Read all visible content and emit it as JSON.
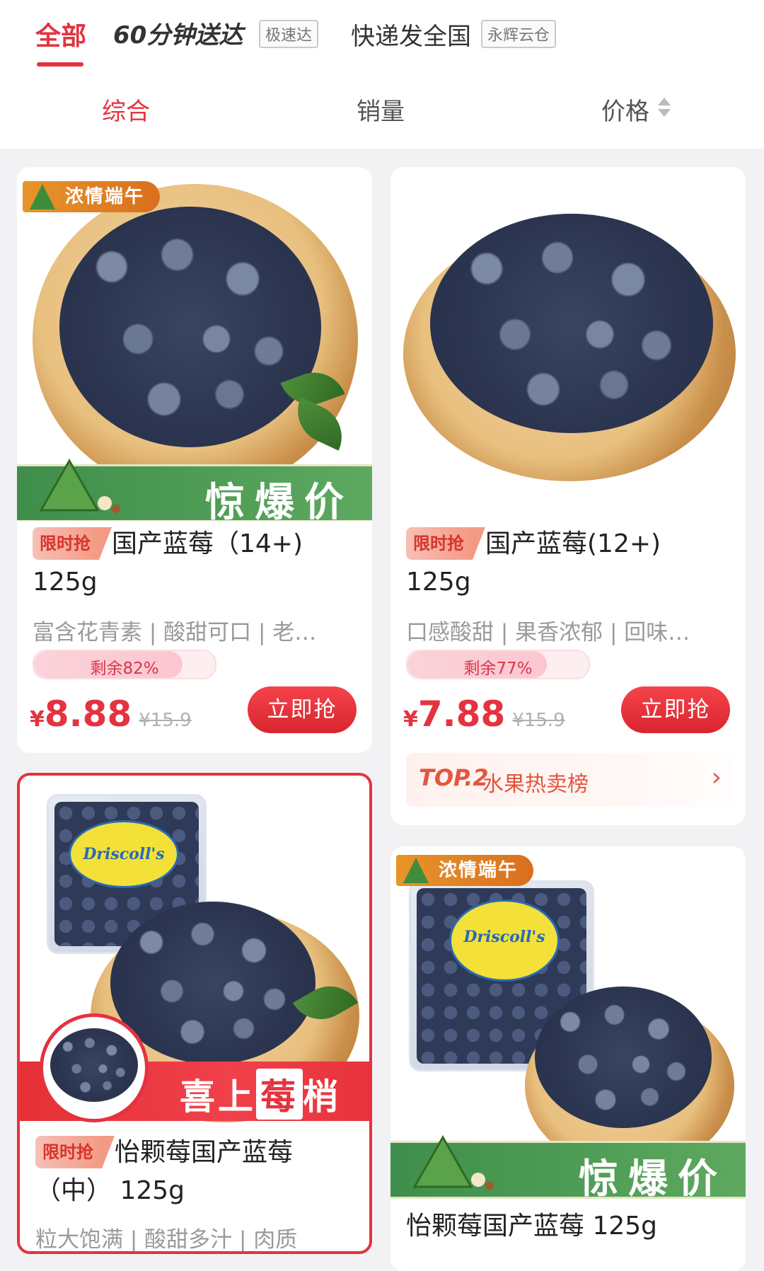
{
  "tabs": {
    "all": "全部",
    "sixty_min": "60分钟送达",
    "sixty_min_tag": "极速达",
    "express": "快递发全国",
    "express_tag": "永辉云仓"
  },
  "sort": {
    "comprehensive": "综合",
    "sales": "销量",
    "price": "价格"
  },
  "products": [
    {
      "ribbon": "浓情端午",
      "banner": "惊爆价",
      "tag": "限时抢",
      "title_line1": "国产蓝莓（14+)",
      "title_line2": "125g",
      "subtitle": "富含花青素 | 酸甜可口 | 老…",
      "remaining": "剩余82%",
      "remaining_fraction": 0.82,
      "currency": "¥",
      "price": "8.88",
      "orig_price": "¥15.9",
      "buy": "立即抢"
    },
    {
      "tag": "限时抢",
      "title_line1": "国产蓝莓(12+)",
      "title_line2": "125g",
      "subtitle": "口感酸甜 | 果香浓郁 | 回味…",
      "remaining": "剩余77%",
      "remaining_fraction": 0.77,
      "currency": "¥",
      "price": "7.88",
      "orig_price": "¥15.9",
      "buy": "立即抢",
      "rank_top": "TOP.2",
      "rank_name": "水果热卖榜",
      "rank_chevron": "›"
    },
    {
      "brand": "Driscoll's",
      "banner_pre": "喜上",
      "banner_hl": "莓",
      "banner_post": "梢",
      "tag": "限时抢",
      "title_line1": "怡颗莓国产蓝莓",
      "title_line2": "（中） 125g",
      "subtitle": "粒大饱满 | 酸甜多汁 | 肉质"
    },
    {
      "ribbon": "浓情端午",
      "brand": "Driscoll's",
      "banner": "惊爆价",
      "title_line1": "怡颗莓国产蓝莓 125g"
    }
  ],
  "colors": {
    "accent": "#e5323f",
    "green_banner": "#4c9a54",
    "background": "#f2f2f4"
  }
}
